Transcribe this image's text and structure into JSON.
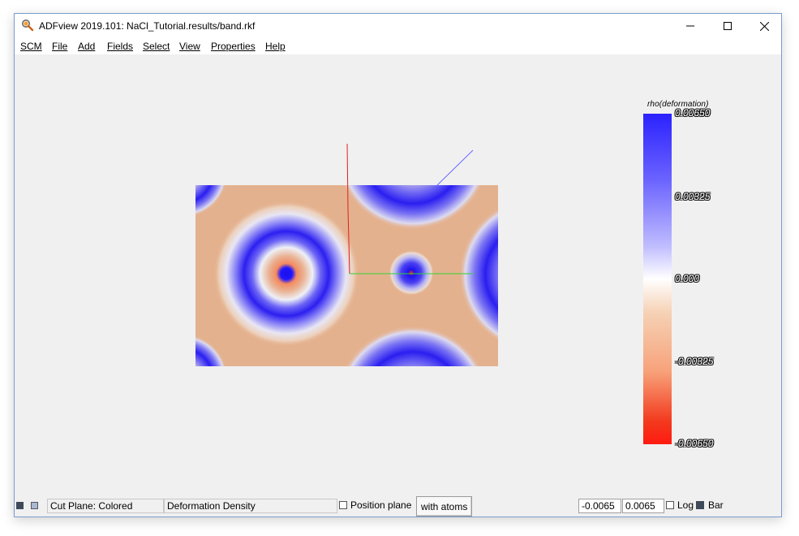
{
  "window": {
    "title": "ADFview 2019.101: NaCl_Tutorial.results/band.rkf",
    "minimize_icon": "minimize-icon",
    "maximize_icon": "maximize-icon",
    "close_icon": "close-icon"
  },
  "menu": {
    "items": [
      "SCM",
      "File",
      "Add",
      "Fields",
      "Select",
      "View",
      "Properties",
      "Help"
    ]
  },
  "colorbar": {
    "title": "rho(deformation)",
    "ticks": [
      "0.00650",
      "0.00325",
      "0.000",
      "-0.00325",
      "-0.00650"
    ],
    "top_color": "#2b22ff",
    "mid_color": "#ffffff",
    "bottom_color": "#ff1a10"
  },
  "axes": {
    "x_color": "#35d235",
    "y_color": "#e02020",
    "z_color": "#6a6aff"
  },
  "statusbar": {
    "cut_plane": "Cut Plane: Colored",
    "field": "Deformation Density",
    "position_plane_label": "Position plane",
    "position_plane_checked": false,
    "with_atoms_label": "with atoms",
    "min_value": "-0.0065",
    "max_value": "0.0065",
    "log_label": "Log",
    "log_checked": false,
    "bar_label": "Bar",
    "bar_checked": true
  }
}
